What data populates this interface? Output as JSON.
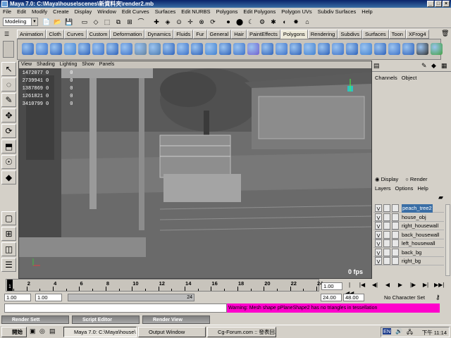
{
  "window": {
    "title": "Maya 7.0: C:\\Maya\\house\\scenes\\新資料夾\\render2.mb"
  },
  "menus": [
    "File",
    "Edit",
    "Modify",
    "Create",
    "Display",
    "Window",
    "Edit Curves",
    "Surfaces",
    "Edit NURBS",
    "Polygons",
    "Edit Polygons",
    "Polygon UVs",
    "Subdiv Surfaces",
    "Help"
  ],
  "status_line": {
    "mode": "Modeling"
  },
  "shelf_tabs": [
    "Animation",
    "Cloth",
    "Curves",
    "Custom",
    "Deformation",
    "Dynamics",
    "Fluids",
    "Fur",
    "General",
    "Hair",
    "PaintEffects",
    "Polygons",
    "Rendering",
    "Subdivs",
    "Surfaces",
    "Toon",
    "XFrog4"
  ],
  "shelf_active": "Polygons",
  "viewport": {
    "menu": [
      "View",
      "Shading",
      "Lighting",
      "Show",
      "Panels"
    ],
    "hud": [
      {
        "value": "1472077",
        "extra": "0",
        "extra2": "0"
      },
      {
        "value": "2739941",
        "extra": "0",
        "extra2": "0"
      },
      {
        "value": "1387869",
        "extra": "0",
        "extra2": "0"
      },
      {
        "value": "1261821",
        "extra": "0",
        "extra2": "0"
      },
      {
        "value": "3410799",
        "extra": "0",
        "extra2": "0"
      }
    ],
    "fps": "0 fps"
  },
  "channel_box": {
    "menu": [
      "Channels",
      "Object"
    ]
  },
  "layer_editor": {
    "radio_display": "Display",
    "radio_render": "Render",
    "menu": [
      "Layers",
      "Options",
      "Help"
    ],
    "layers": [
      {
        "vis": "V",
        "name": "peach_tree2",
        "selected": true
      },
      {
        "vis": "V",
        "name": "house_obj",
        "selected": false
      },
      {
        "vis": "V",
        "name": "right_housewall",
        "selected": false
      },
      {
        "vis": "V",
        "name": "back_housewall",
        "selected": false
      },
      {
        "vis": "V",
        "name": "left_housewall",
        "selected": false
      },
      {
        "vis": "V",
        "name": "back_bg",
        "selected": false
      },
      {
        "vis": "V",
        "name": "right_bg",
        "selected": false
      }
    ]
  },
  "timeline": {
    "ticks": [
      "2",
      "4",
      "6",
      "8",
      "10",
      "12",
      "14",
      "16",
      "18",
      "20",
      "22",
      "24"
    ],
    "current_frame": "1",
    "current_field": "1.00",
    "range_start": "1.00",
    "range_start2": "1.00",
    "range_end": "24.00",
    "range_end2": "48.00",
    "range_label": "24",
    "character_set": "No Character Set"
  },
  "warning": "Warning: Mesh shape pPlaneShape2 has no triangles in tessellation",
  "panels": [
    "Render Sett",
    "Script Editor",
    "Render View"
  ],
  "taskbar": {
    "start": "開始",
    "items": [
      "Maya 7.0: C:\\Maya\\house\\...",
      "Output Window",
      "Cg-Forum.com :: 發表回..."
    ],
    "lang": "EN",
    "time": "下午 11:14"
  }
}
